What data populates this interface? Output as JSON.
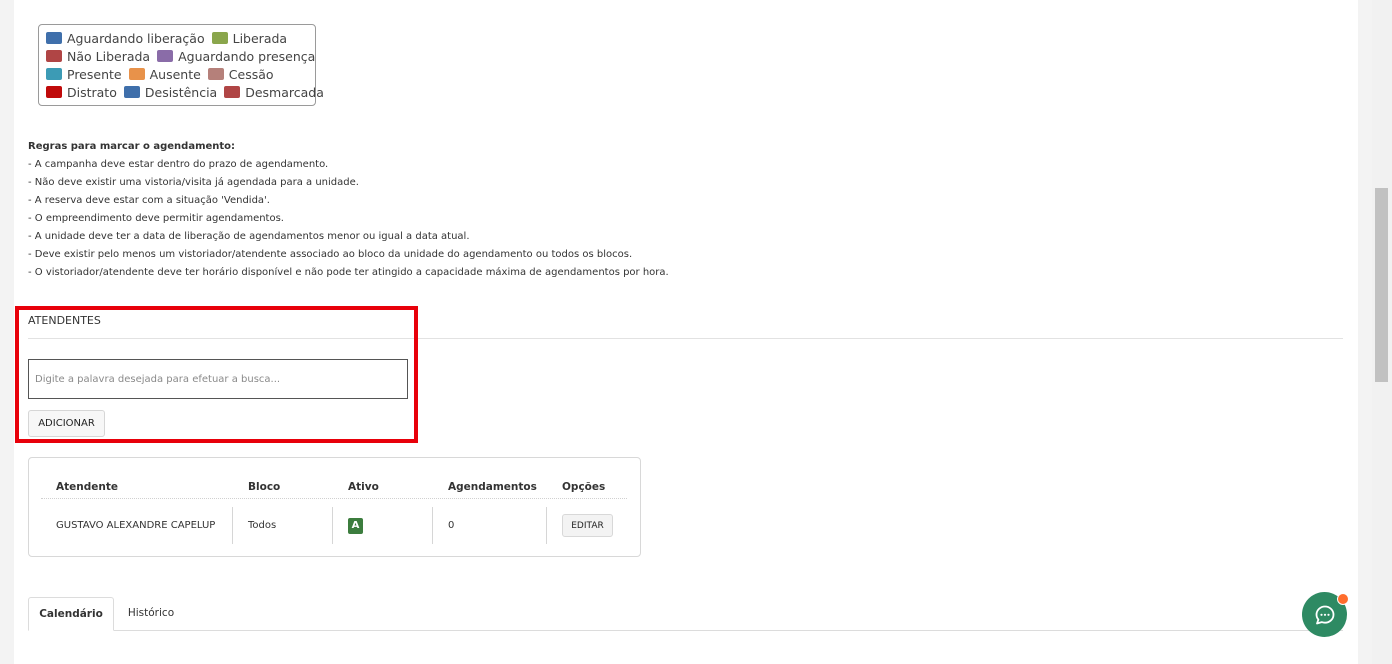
{
  "legend": {
    "rows": [
      [
        {
          "label": "Aguardando liberação",
          "color": "#3f6fab"
        },
        {
          "label": "Liberada",
          "color": "#8aa64c"
        }
      ],
      [
        {
          "label": "Não Liberada",
          "color": "#b04545"
        },
        {
          "label": "Aguardando presença",
          "color": "#8a6ca8"
        }
      ],
      [
        {
          "label": "Presente",
          "color": "#3c9bb5"
        },
        {
          "label": "Ausente",
          "color": "#e8924a"
        },
        {
          "label": "Cessão",
          "color": "#b5807a"
        }
      ],
      [
        {
          "label": "Distrato",
          "color": "#c00a0a"
        },
        {
          "label": "Desistência",
          "color": "#3f6fab"
        },
        {
          "label": "Desmarcada",
          "color": "#b04545"
        }
      ]
    ]
  },
  "rules": {
    "title": "Regras para marcar o agendamento:",
    "items": [
      "- A campanha deve estar dentro do prazo de agendamento.",
      "- Não deve existir uma vistoria/visita já agendada para a unidade.",
      "- A reserva deve estar com a situação 'Vendida'.",
      "- O empreendimento deve permitir agendamentos.",
      "- A unidade deve ter a data de liberação de agendamentos menor ou igual a data atual.",
      "- Deve existir pelo menos um vistoriador/atendente associado ao bloco da unidade do agendamento ou todos os blocos.",
      "- O vistoriador/atendente deve ter horário disponível e não pode ter atingido a capacidade máxima de agendamentos por hora."
    ]
  },
  "atendentes": {
    "title": "ATENDENTES",
    "search_placeholder": "Digite a palavra desejada para efetuar a busca...",
    "search_value": "",
    "add_label": "ADICIONAR"
  },
  "table": {
    "headers": {
      "atendente": "Atendente",
      "bloco": "Bloco",
      "ativo": "Ativo",
      "agendamentos": "Agendamentos",
      "opcoes": "Opções"
    },
    "rows": [
      {
        "atendente": "GUSTAVO ALEXANDRE CAPELUP",
        "bloco": "Todos",
        "ativo": "A",
        "agendamentos": "0",
        "edit_label": "EDITAR"
      }
    ]
  },
  "tabs": [
    "Calendário",
    "Histórico"
  ],
  "colors": {
    "highlight": "#e8000a",
    "active_badge": "#3c7d3e",
    "chat": "#2e8a63",
    "chat_notification": "#ff6d2d"
  },
  "icons": {
    "chat": "chat-bubble-icon"
  }
}
